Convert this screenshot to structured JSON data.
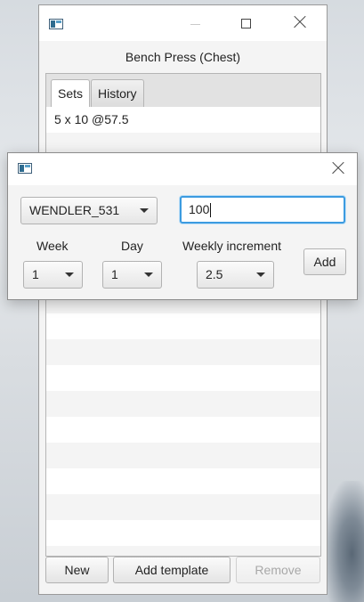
{
  "main_window": {
    "title": "Bench Press (Chest)",
    "tabs": [
      {
        "label": "Sets",
        "selected": true
      },
      {
        "label": "History",
        "selected": false
      }
    ],
    "sets_list": [
      "5 x 10 @57.5",
      "",
      "",
      "",
      "",
      "",
      "",
      "",
      "",
      "",
      "",
      "",
      "",
      "",
      "",
      "",
      "",
      ""
    ],
    "buttons": {
      "new": "New",
      "add_template": "Add template",
      "remove": "Remove"
    }
  },
  "dialog": {
    "template_select": {
      "value": "WENDLER_531"
    },
    "weight_field": {
      "value": "100"
    },
    "week": {
      "label": "Week",
      "value": "1"
    },
    "day": {
      "label": "Day",
      "value": "1"
    },
    "weekly_increment": {
      "label": "Weekly increment",
      "value": "2.5"
    },
    "add_button": "Add"
  },
  "colors": {
    "focus_accent": "#3c9be0",
    "window_bg": "#f4f4f4"
  }
}
